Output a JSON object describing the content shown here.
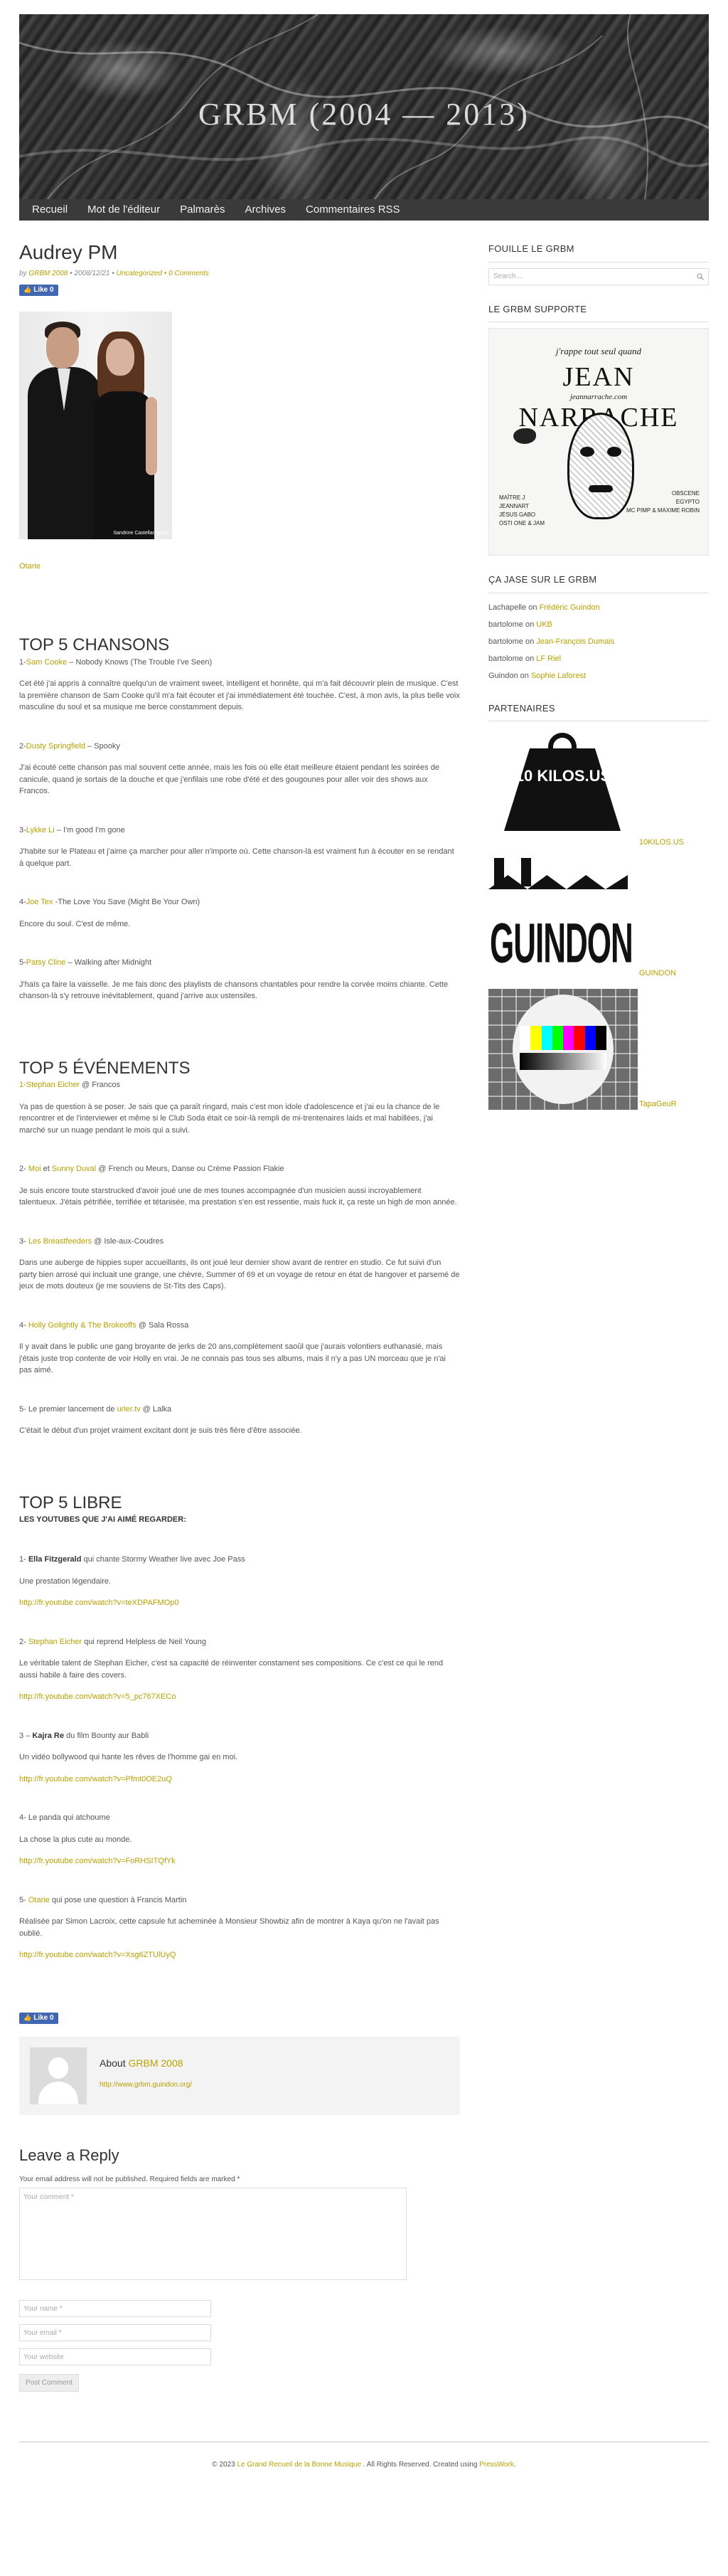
{
  "site": {
    "title": "GRBM (2004 — 2013)"
  },
  "nav": [
    "Recueil",
    "Mot de l'éditeur",
    "Palmarès",
    "Archives",
    "Commentaires RSS"
  ],
  "post": {
    "title": "Audrey PM",
    "meta_by": "by",
    "meta_author": "GRBM 2008",
    "meta_date": "• 2008/12/21 •",
    "meta_category": "Uncategorized",
    "meta_comments": "• 0 Comments",
    "fb_like": "Like 0",
    "photo_credit": "Sandrine Castellan photo",
    "tag": "Otarie"
  },
  "chansons": {
    "heading": "TOP 5 CHANSONS",
    "items": [
      {
        "num": "1-",
        "artist": "Sam Cooke",
        "rest": " – Nobody Knows (The Trouble I've Seen)",
        "body": "Cet été j'ai appris à connaître quelqu'un de vraiment sweet, intelligent et honnête, qui m'a fait découvrir plein de musique. C'est la première chanson de Sam Cooke qu'il m'a fait écouter et j'ai immédiatement été touchée. C'est, à mon avis, la plus belle voix masculine du soul et sa musique me berce constamment depuis."
      },
      {
        "num": "2-",
        "artist": "Dusty Springfield",
        "rest": " – Spooky",
        "body": "J'ai écouté cette chanson pas mal souvent cette année, mais les fois où elle était meilleure étaient pendant les soirées de canicule, quand je sortais de la douche et que j'enfilais une robe d'été et des gougounes pour aller voir des shows aux Francos."
      },
      {
        "num": "3-",
        "artist": "Lykke Li",
        "rest": " – I'm good I'm gone",
        "body": "J'habite sur le Plateau et j'aime ça marcher pour aller n'importe où. Cette chanson-là est vraiment fun à écouter en se rendant à quelque part."
      },
      {
        "num": "4-",
        "artist": "Joe Tex",
        "rest": " -The Love You Save (Might Be Your Own)",
        "body": "Encore du soul. C'est de même."
      },
      {
        "num": "5-",
        "artist": "Patsy Cline",
        "rest": " – Walking after Midnight",
        "body": "J'haïs ça faire la vaisselle. Je me fais donc des playlists de chansons chantables pour rendre la corvée moins chiante. Cette chanson-là s'y retrouve inévitablement, quand j'arrive aux ustensiles."
      }
    ]
  },
  "evenements": {
    "heading": "TOP 5 ÉVÉNEMENTS",
    "items": [
      {
        "prefix": "",
        "linked": "1-Stephan Eicher",
        "rest": " @ Francos",
        "body": "Ya pas de question à se poser. Je sais que ça paraît ringard, mais c'est mon idole d'adolescence et j'ai eu la chance de le rencontrer et de l'interviewer et même si le Club Soda était ce soir-là rempli de mi-trentenaires laids et mal habillées, j'ai marché sur un nuage pendant le mois qui a suivi."
      },
      {
        "prefix": "2- ",
        "linked": "Moi",
        "mid": " et ",
        "linked2": "Sunny Duval",
        "rest": " @ French ou Meurs, Danse ou Crème Passion Flakie",
        "body": "Je suis encore toute starstrucked d'avoir joué une de mes tounes accompagnée d'un musicien aussi incroyablement talentueux. J'étais pétrifiée, terrifiée et tétanisée, ma prestation s'en est ressentie, mais fuck it, ça reste un high de mon année."
      },
      {
        "prefix": "3- ",
        "linked": "Les Breastfeeders",
        "rest": " @ Isle-aux-Coudres",
        "body": "Dans une auberge de hippies super accueillants, ils ont joué leur dernier show avant de rentrer en studio. Ce fut suivi d'un party bien arrosé qui incluait une grange, une chèvre, Summer of 69 et un voyage de retour en état de hangover et parsemé de jeux de mots douteux (je me souviens de St-Tits des Caps)."
      },
      {
        "prefix": "4- ",
        "linked": "Holly Golightly & The Brokeoffs",
        "rest": " @ Sala Rossa",
        "body": "Il y avait dans le public une gang broyante de jerks de 20 ans,complètement saoûl que j'aurais volontiers euthanasié, mais j'étais juste trop contente de voir Holly en vrai. Je ne connais pas tous ses albums, mais il n'y a pas UN morceau que je n'ai pas aimé."
      },
      {
        "prefix": "5- Le premier lancement de ",
        "linked": "urler.tv",
        "rest": " @ Lalka",
        "body": "C'était le début d'un projet vraiment excitant dont je suis très fière d'être associée."
      }
    ]
  },
  "libre": {
    "heading": "TOP 5 LIBRE",
    "subheading": "LES YOUTUBES QUE J'AI AIMÉ REGARDER:",
    "items": [
      {
        "prefix": "1- ",
        "name": "Ella Fitzgerald",
        "name_linked": false,
        "rest": " qui chante Stormy Weather live avec Joe Pass",
        "body": "Une prestation légendaire.",
        "url": "http://fr.youtube.com/watch?v=teXDPAFMOp0"
      },
      {
        "prefix": "2- ",
        "name": "Stephan Eicher",
        "name_linked": true,
        "rest": " qui reprend Helpless de Neil Young",
        "body": "Le véritable talent de Stephan Eicher, c'est sa capacité de réinventer constament ses compositions. Ce c'est ce qui le rend aussi habile à faire des covers.",
        "url": "http://fr.youtube.com/watch?v=5_pc767XECo"
      },
      {
        "prefix": "3 – ",
        "name": "Kajra Re",
        "name_linked": false,
        "rest": " du film Bounty aur Babli",
        "body": "Un vidéo bollywood qui hante les rêves de l'homme gai en moi.",
        "url": "http://fr.youtube.com/watch?v=Pfmt0OE2uQ"
      },
      {
        "prefix": "4- Le panda qui atchoume",
        "name": "",
        "name_linked": false,
        "rest": "",
        "body": "La chose la plus cute au monde.",
        "url": "http://fr.youtube.com/watch?v=FoRHSITQfYk"
      },
      {
        "prefix": "5- ",
        "name": "Otarie",
        "name_linked": true,
        "rest": " qui pose une question à Francis Martin",
        "body": "Réalisée par Simon Lacroix, cette capsule fut acheminée à Monsieur Showbiz afin de montrer à Kaya qu'on ne l'avait pas oublié.",
        "url": "http://fr.youtube.com/watch?v=Xsg6ZTUlUyQ"
      }
    ]
  },
  "author": {
    "about": "About",
    "name": "GRBM 2008",
    "url": "http://www.grbm.guindon.org/"
  },
  "reply": {
    "heading": "Leave a Reply",
    "note": "Your email address will not be published. Required fields are marked *",
    "comment_placeholder": "Your comment *",
    "name_placeholder": "Your name *",
    "email_placeholder": "Your email *",
    "website_placeholder": "Your website",
    "submit": "Post Comment"
  },
  "sidebar": {
    "search_heading": "FOUILLE LE GRBM",
    "search_placeholder": "Search...",
    "support_heading": "LE GRBM SUPPORTE",
    "ad": {
      "top": "j'rappe tout seul quand",
      "name": "JEAN NARRACHE",
      "url": "jeannarrache.com",
      "left": [
        "MAÎTRE J",
        "JEANNART",
        "JÉSUS GABO",
        "OSTI ONE & JAM"
      ],
      "right": [
        "OBSCENE",
        "EGYPTO",
        "MC PIMP & MAXIME ROBIN"
      ]
    },
    "jase_heading": "ÇA JASE SUR LE GRBM",
    "jase": [
      {
        "who": "Lachapelle",
        "on": " on ",
        "post": "Frédéric Guindon"
      },
      {
        "who": "bartolome",
        "on": " on ",
        "post": "UKB"
      },
      {
        "who": "bartolome",
        "on": " on ",
        "post": "Jean-François Dumais"
      },
      {
        "who": "bartolome",
        "on": " on ",
        "post": "LF Riel"
      },
      {
        "who": "Guindon",
        "on": " on ",
        "post": "Sophie Laforest"
      }
    ],
    "partners_heading": "PARTENAIRES",
    "partners": [
      {
        "label": "10KILOS.US",
        "img_text": "10 KILOS.US"
      },
      {
        "label": "GUINDON",
        "img_text": "GUINDON"
      },
      {
        "label": "TapaGeuR",
        "img_text": ""
      }
    ]
  },
  "footer": {
    "prefix": "© 2023 ",
    "site": "Le Grand Recueil de la Bonne Musique",
    "middle": " . All Rights Reserved. Created using ",
    "tool": "PressWork",
    "suffix": "."
  },
  "colors": {
    "accent": "#b8a100",
    "nav_bg": "#3a3a3a",
    "fb_blue": "#4267b2"
  }
}
